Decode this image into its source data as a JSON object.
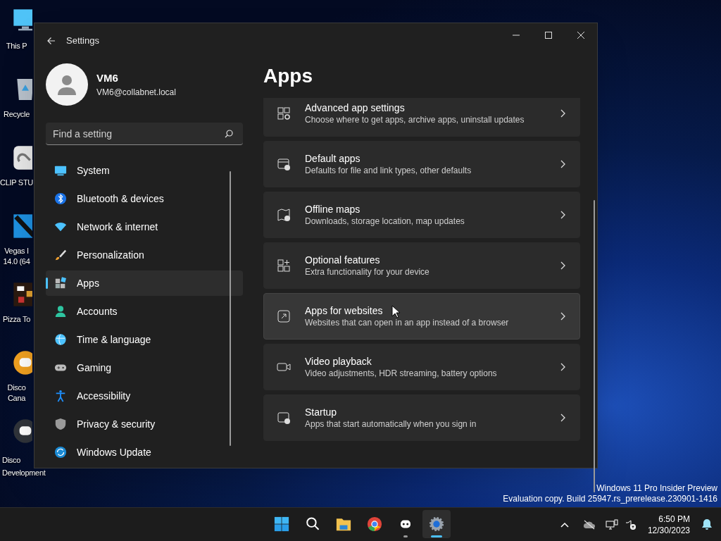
{
  "desktop_icons": [
    {
      "kind": "covered",
      "lines": [
        "This P"
      ]
    },
    {
      "kind": "covered",
      "lines": [
        "Recycle"
      ]
    },
    {
      "kind": "covered",
      "lines": [
        "CLIP STU"
      ]
    },
    {
      "kind": "covered",
      "lines": [
        "Vegas I",
        "14.0 (64"
      ]
    },
    {
      "kind": "covered",
      "lines": [
        "Pizza To"
      ]
    },
    {
      "kind": "covered",
      "lines": [
        "Disco",
        "Cana"
      ]
    },
    {
      "kind": "shown",
      "lines": [
        "Disco",
        "Development"
      ]
    }
  ],
  "window": {
    "title": "Settings"
  },
  "profile": {
    "name": "VM6",
    "email": "VM6@collabnet.local"
  },
  "search": {
    "placeholder": "Find a setting"
  },
  "sidebar": {
    "items": [
      {
        "label": "System",
        "selected": false
      },
      {
        "label": "Bluetooth & devices",
        "selected": false
      },
      {
        "label": "Network & internet",
        "selected": false
      },
      {
        "label": "Personalization",
        "selected": false
      },
      {
        "label": "Apps",
        "selected": true
      },
      {
        "label": "Accounts",
        "selected": false
      },
      {
        "label": "Time & language",
        "selected": false
      },
      {
        "label": "Gaming",
        "selected": false
      },
      {
        "label": "Accessibility",
        "selected": false
      },
      {
        "label": "Privacy & security",
        "selected": false
      },
      {
        "label": "Windows Update",
        "selected": false
      }
    ]
  },
  "page": {
    "title": "Apps",
    "cards": [
      {
        "title": "Advanced app settings",
        "description": "Choose where to get apps, archive apps, uninstall updates",
        "hovered": false
      },
      {
        "title": "Default apps",
        "description": "Defaults for file and link types, other defaults",
        "hovered": false
      },
      {
        "title": "Offline maps",
        "description": "Downloads, storage location, map updates",
        "hovered": false
      },
      {
        "title": "Optional features",
        "description": "Extra functionality for your device",
        "hovered": false
      },
      {
        "title": "Apps for websites",
        "description": "Websites that can open in an app instead of a browser",
        "hovered": true
      },
      {
        "title": "Video playback",
        "description": "Video adjustments, HDR streaming, battery options",
        "hovered": false
      },
      {
        "title": "Startup",
        "description": "Apps that start automatically when you sign in",
        "hovered": false
      }
    ]
  },
  "watermark": [
    "Windows 11 Pro Insider Preview",
    "Evaluation copy. Build 25947.rs_prerelease.230901-1416"
  ],
  "taskbar": {
    "apps": [
      {
        "kind": "start",
        "active": false
      },
      {
        "kind": "search",
        "active": false
      },
      {
        "kind": "folder",
        "active": false
      },
      {
        "kind": "browser",
        "active": false
      },
      {
        "kind": "chat",
        "active": false,
        "running": true
      },
      {
        "kind": "settings",
        "active": true,
        "running": true
      }
    ],
    "time": "6:50 PM",
    "date": "12/30/2023"
  }
}
